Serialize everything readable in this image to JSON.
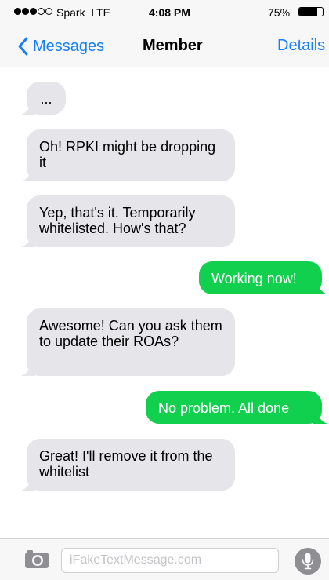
{
  "status_bar": {
    "carrier": "Spark  LTE",
    "signal_bars_filled": 3,
    "signal_bars_total": 5,
    "time": "4:08 PM",
    "battery_percent": "75%",
    "battery_level": 0.75
  },
  "nav": {
    "back_label": "Messages",
    "title": "Member",
    "details_label": "Details"
  },
  "messages": [
    {
      "direction": "in",
      "text": "..."
    },
    {
      "direction": "in",
      "text": "Oh! RPKI might be dropping it"
    },
    {
      "direction": "in",
      "text": "Yep, that's it. Temporarily whitelisted. How's that?"
    },
    {
      "direction": "out",
      "text": "Working now!"
    },
    {
      "direction": "in",
      "text": "Awesome! Can you ask them to update their ROAs?"
    },
    {
      "direction": "out",
      "text": "No problem. All done"
    },
    {
      "direction": "in",
      "text": "Great! I'll remove it from the whitelist"
    }
  ],
  "input": {
    "placeholder": "iFakeTextMessage.com",
    "value": ""
  },
  "colors": {
    "accent_blue": "#147efb",
    "incoming_bubble": "#e5e5ea",
    "outgoing_bubble": "#11d04e",
    "bar_background": "#f7f7f8"
  },
  "icons": {
    "back": "chevron-left-icon",
    "camera": "camera-icon",
    "mic": "microphone-icon"
  }
}
